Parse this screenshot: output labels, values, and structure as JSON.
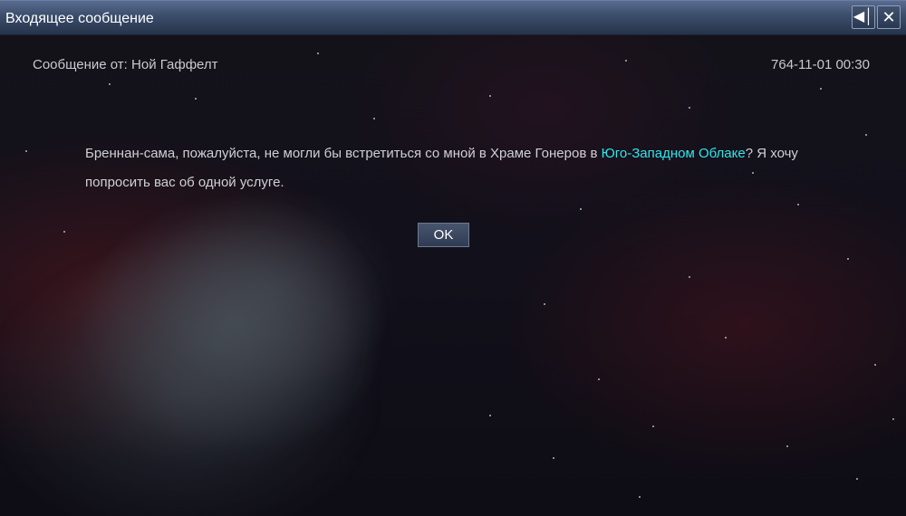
{
  "window": {
    "title": "Входящее сообщение"
  },
  "message": {
    "sender_label": "Сообщение от: Ной Гаффелт",
    "datetime": "764-11-01  00:30",
    "text_before_link": "Бреннан-сама, пожалуйста, не могли бы встретиться со мной в Храме Гонеров в ",
    "link_text": "Юго-Западном Облаке",
    "text_after_link": "? Я хочу попросить вас об одной услуге."
  },
  "buttons": {
    "ok_label": "OK",
    "sound_icon": "speaker-icon",
    "close_icon": "close-icon"
  },
  "colors": {
    "link": "#2ee6ee",
    "titlebar": "#3e506f"
  }
}
